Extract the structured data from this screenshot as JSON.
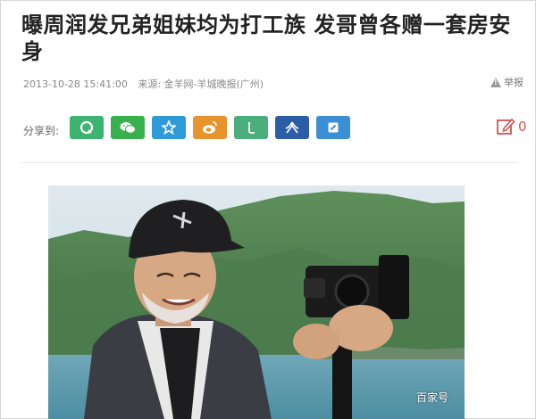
{
  "article": {
    "headline": "曝周润发兄弟姐妹均为打工族 发哥曾各赠一套房安身",
    "datetime": "2013-10-28 15:41:00",
    "source": "来源: 金羊网-羊城晚报(广州)",
    "report_label": "举报",
    "share_label": "分享到:",
    "comment_count": "0",
    "watermark": "百家号"
  },
  "share_buttons": [
    {
      "name": "qq-share-button",
      "icon": "qq-icon",
      "color": "#3cb371"
    },
    {
      "name": "wechat-share-button",
      "icon": "wechat-icon",
      "color": "#36b14c"
    },
    {
      "name": "qzone-share-button",
      "icon": "star-icon",
      "color": "#2f9ad8"
    },
    {
      "name": "weibo-share-button",
      "icon": "weibo-icon",
      "color": "#e8932d"
    },
    {
      "name": "tencent-weibo-share-button",
      "icon": "tencent-icon",
      "color": "#4cae7a"
    },
    {
      "name": "renren-share-button",
      "icon": "renren-icon",
      "color": "#2c5ea8"
    },
    {
      "name": "douban-share-button",
      "icon": "douban-icon",
      "color": "#3a8fd5"
    }
  ]
}
